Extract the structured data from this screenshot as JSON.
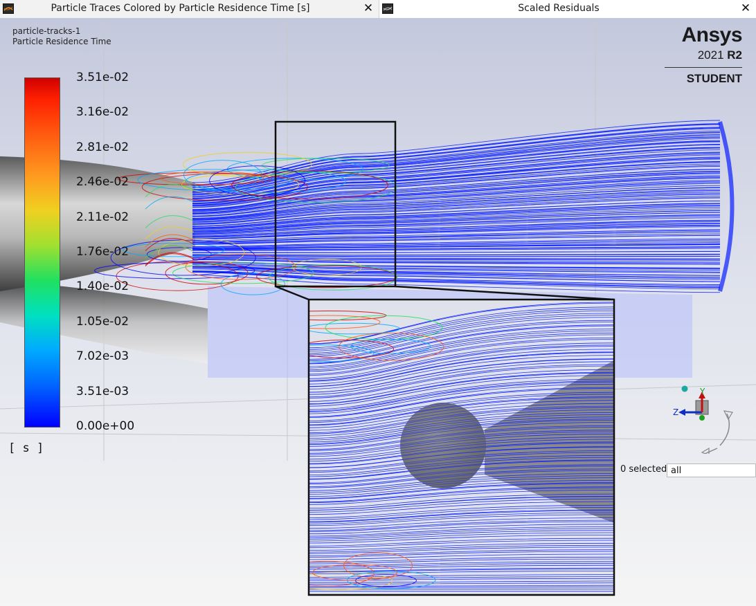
{
  "tabs": [
    {
      "title": "Particle Traces Colored by Particle Residence Time [s]",
      "close": "✕",
      "active": true
    },
    {
      "title": "Scaled Residuals",
      "close": "✕",
      "active": false
    }
  ],
  "caption": {
    "object_name": "particle-tracks-1",
    "quantity": "Particle Residence Time"
  },
  "colorbar": {
    "ticks": [
      "3.51e-02",
      "3.16e-02",
      "2.81e-02",
      "2.46e-02",
      "2.11e-02",
      "1.76e-02",
      "1.40e-02",
      "1.05e-02",
      "7.02e-03",
      "3.51e-03",
      "0.00e+00"
    ],
    "unit": "[ s ]",
    "colors": [
      "#0000ff",
      "#00aaff",
      "#20e060",
      "#f0d020",
      "#ff5a10",
      "#d00000"
    ]
  },
  "brand": {
    "name": "Ansys",
    "version_year": "2021",
    "version_release": "R2",
    "edition": "STUDENT"
  },
  "triad": {
    "y_axis": "Y",
    "z_axis": "Z"
  },
  "selection": {
    "count_label": "0 selected",
    "filter_value": "all"
  },
  "colors": {
    "trace_blue": "#0a1eff",
    "body_gray": "#8c8c8c",
    "background_top": "#c4c9dd",
    "background_bottom": "#f4f4f4"
  }
}
